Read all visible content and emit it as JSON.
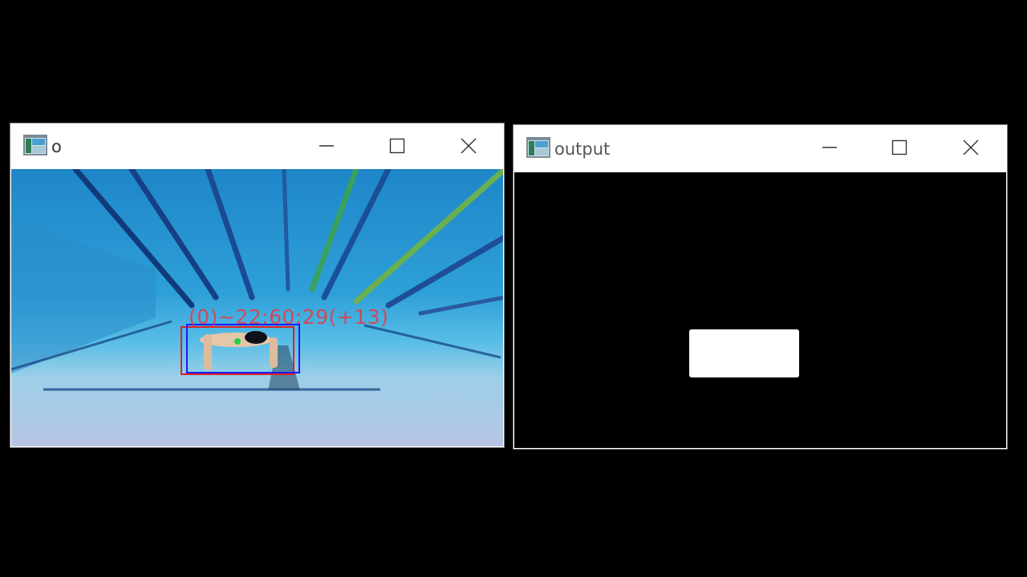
{
  "windows": [
    {
      "title": "o",
      "controls": {
        "minimize": "minimize",
        "maximize": "maximize",
        "close": "close"
      },
      "overlay_label": "(0)~22:60:29(+13)",
      "box_colors": {
        "detection": "#e02020",
        "tracking": "#1a1aff",
        "marker": "#20d040"
      }
    },
    {
      "title": "output",
      "controls": {
        "minimize": "minimize",
        "maximize": "maximize",
        "close": "close"
      }
    }
  ],
  "icons": [
    "app-icon",
    "minimize-icon",
    "maximize-icon",
    "close-icon"
  ]
}
